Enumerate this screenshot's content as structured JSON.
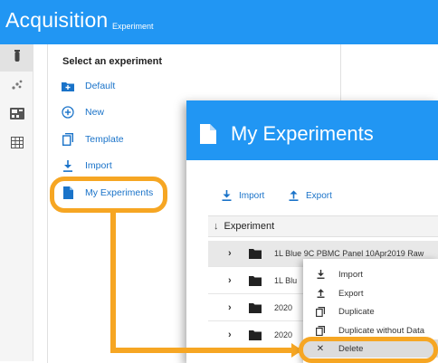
{
  "app": {
    "title": "Acquisition",
    "subtitle": "Experiment"
  },
  "rail": {
    "items": [
      "flask-icon",
      "scatter-icon",
      "instrument-icon",
      "grid-icon"
    ],
    "active": 0
  },
  "experiment_list": {
    "heading": "Select an experiment",
    "items": [
      {
        "label": "Default",
        "icon": "folder-plus-icon"
      },
      {
        "label": "New",
        "icon": "circle-plus-icon"
      },
      {
        "label": "Template",
        "icon": "copy-icon"
      },
      {
        "label": "Import",
        "icon": "download-icon"
      },
      {
        "label": "My Experiments",
        "icon": "document-icon"
      }
    ]
  },
  "dialog": {
    "title": "My Experiments",
    "toolbar": {
      "import_label": "Import",
      "export_label": "Export"
    },
    "column_header": "Experiment",
    "rows": [
      {
        "name": "1L Blue 9C PBMC Panel 10Apr2019 Raw"
      },
      {
        "name": "1L Blu"
      },
      {
        "name": "2020"
      },
      {
        "name": "2020"
      }
    ]
  },
  "context_menu": {
    "items": [
      {
        "label": "Import",
        "icon": "download-icon"
      },
      {
        "label": "Export",
        "icon": "upload-icon"
      },
      {
        "label": "Duplicate",
        "icon": "copy-icon"
      },
      {
        "label": "Duplicate without Data",
        "icon": "copy-icon"
      },
      {
        "label": "Delete",
        "icon": "close-icon"
      }
    ],
    "highlighted": "Delete"
  },
  "colors": {
    "primary": "#2196f3",
    "highlight": "#f6a623",
    "link": "#1a73c9"
  }
}
